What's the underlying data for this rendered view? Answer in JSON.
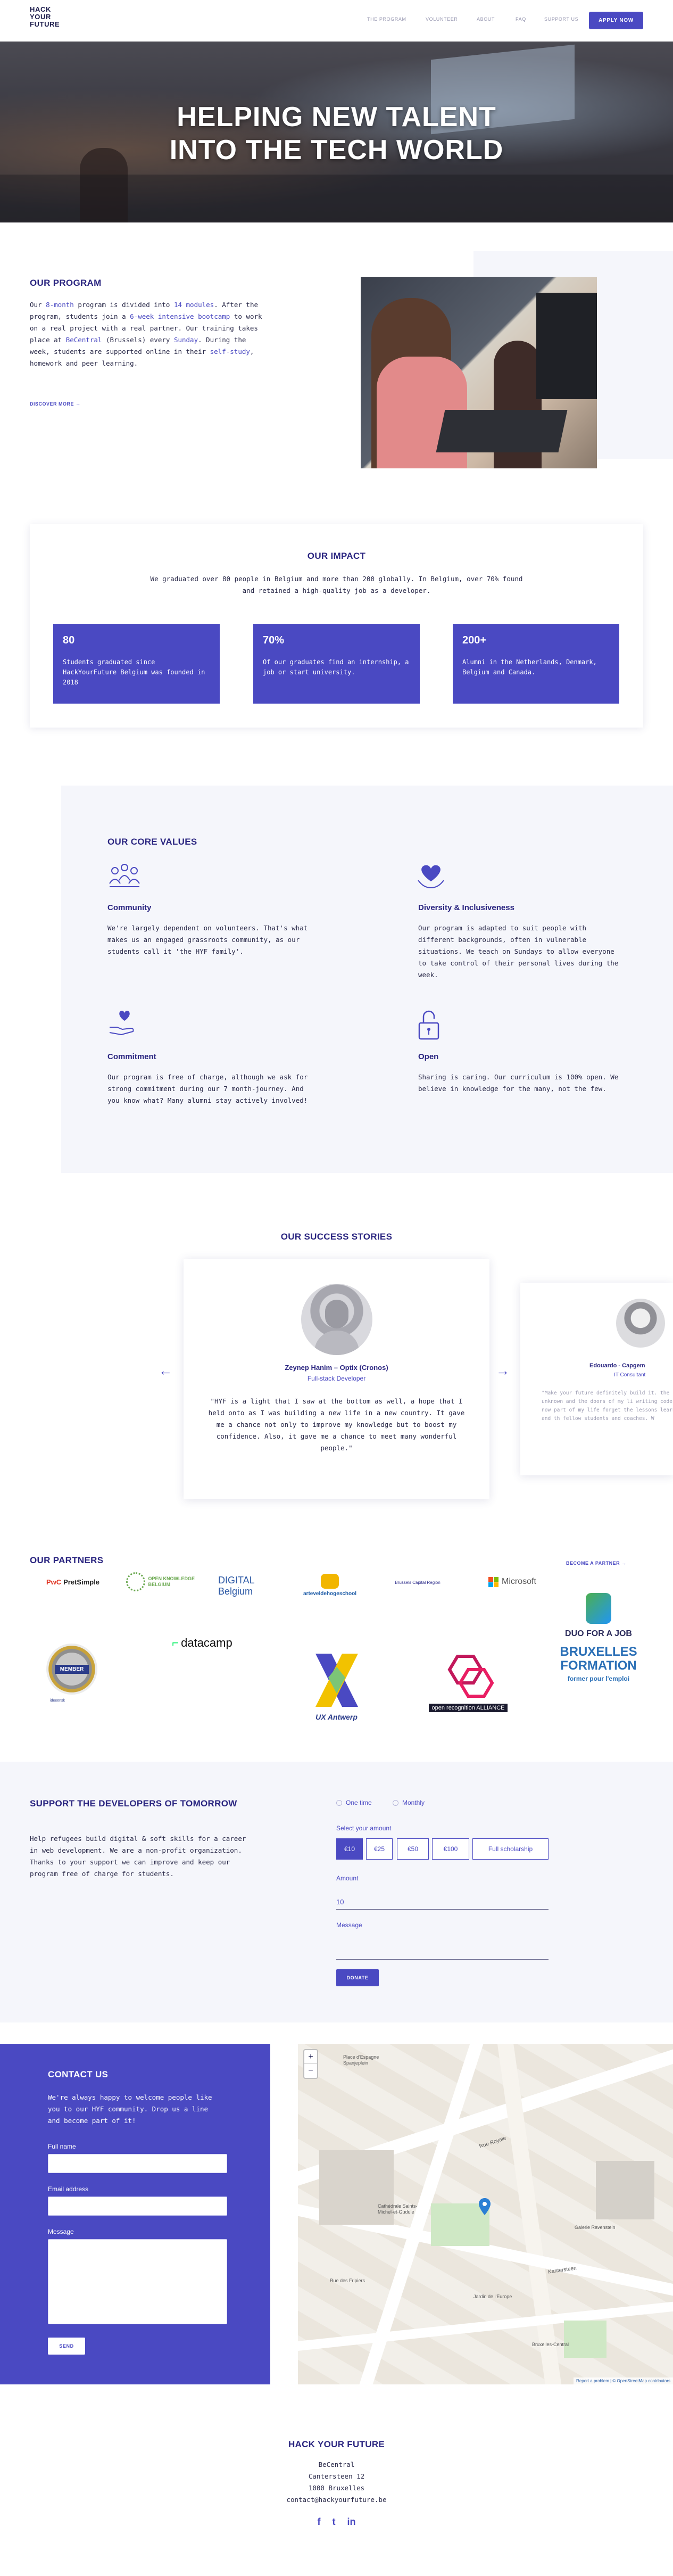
{
  "header": {
    "logo_lines": [
      "HACK",
      "YOUR",
      "FUTURE"
    ],
    "nav": [
      "THE PROGRAM",
      "VOLUNTEER",
      "ABOUT",
      "FAQ",
      "SUPPORT US"
    ],
    "apply_label": "APPLY NOW"
  },
  "hero": {
    "title_line1": "HELPING NEW TALENT",
    "title_line2": "INTO THE TECH WORLD"
  },
  "program": {
    "title": "OUR PROGRAM",
    "p1": "Our ",
    "p1_link": "8-month",
    "p2": " program is divided into ",
    "p2_link": "14 modules",
    "p3": ". After the program, students join a ",
    "p3_link": "6-week intensive bootcamp",
    "p4": " to work on a real project with a real partner. Our training takes place at ",
    "p4_link": "BeCentral",
    "p5": " (Brussels) every ",
    "p5_link": "Sunday",
    "p6": ". During the week, students are supported online in their ",
    "p6_link": "self-study",
    "p7": ", homework and peer learning.",
    "discover_label": "DISCOVER MORE",
    "discover_arrow": "→"
  },
  "impact": {
    "title": "OUR IMPACT",
    "text": "We graduated over 80 people in Belgium and more than 200 globally. In Belgium, over 70% found and retained a high-quality job as a developer.",
    "cards": [
      {
        "num": "80",
        "text": "Students graduated since HackYourFuture Belgium was founded in 2018"
      },
      {
        "num": "70%",
        "text": "Of our graduates find an internship, a job or start university."
      },
      {
        "num": "200+",
        "text": "Alumni in the Netherlands, Denmark, Belgium and Canada."
      }
    ]
  },
  "values": {
    "title": "OUR CORE VALUES",
    "items": [
      {
        "title": "Community",
        "text": "We're largely dependent on volunteers. That's what makes us an engaged grassroots community, as our students call it 'the HYF family'.",
        "icon": "community-icon"
      },
      {
        "title": "Diversity & Inclusiveness",
        "text": "Our program is adapted to suit people with different backgrounds, often in vulnerable situations. We teach on Sundays to allow everyone to take control of their personal lives during the week.",
        "icon": "heart-hands-icon"
      },
      {
        "title": "Commitment",
        "text": "Our program is free of charge, although we ask for strong commitment during our 7 month-journey. And you know what? Many alumni stay actively involved!",
        "icon": "hand-heart-icon"
      },
      {
        "title": "Open",
        "text": "Sharing is caring. Our curriculum is 100% open. We believe in knowledge for the many, not the few.",
        "icon": "open-lock-icon"
      }
    ]
  },
  "stories": {
    "title": "OUR SUCCESS STORIES",
    "main": {
      "name": "Zeynep Hanim – Optix (Cronos)",
      "role": "Full-stack Developer",
      "quote": "\"HYF is a light that I saw at the bottom as well, a hope that I held onto  as I was building a new life in a new country. It gave me a chance not  only to improve my knowledge but to boost my confidence. Also, it gave me a chance to meet many  wonderful people.\""
    },
    "side": {
      "name": "Edouardo - Capgem",
      "role": "IT Consultant",
      "quote": "\"Make your future definitely build it. the unknown and the doors of my li writing code is now part of my life forget the lessons learned and th fellow students and coaches. W"
    },
    "prev_arrow": "←",
    "next_arrow": "→"
  },
  "partners": {
    "title": "OUR PARTNERS",
    "become_label": "BECOME A PARTNER",
    "become_arrow": "→",
    "logos": [
      "PwC",
      "PretSimple",
      "OPEN KNOWLEDGE BELGIUM",
      "DIGITAL Belgium",
      "arteveldehogeschool",
      "Brussels Capital Region",
      "Microsoft",
      "MEMBER",
      "datacamp",
      "UX Antwerp",
      "open recognition ALLIANCE",
      "DUO FOR A JOB",
      "BRUXELLES FORMATION",
      "former pour l'emploi",
      "ideeënsk"
    ]
  },
  "support": {
    "title": "SUPPORT THE DEVELOPERS OF TOMORROW",
    "text": "Help refugees build digital & soft skills for a career in web development. We are a non-profit organization. Thanks to your support we can improve and keep our program free of charge for students.",
    "freq_options": [
      "One time",
      "Monthly"
    ],
    "amount_label": "Select your amount",
    "amounts": [
      "€10",
      "€25",
      "€50",
      "€100",
      "Full scholarship"
    ],
    "amount_field_label": "Amount",
    "amount_value": "10",
    "message_label": "Message",
    "donate_label": "DONATE"
  },
  "contact": {
    "title": "CONTACT US",
    "text": "We're always happy to welcome people like you to our HYF community. Drop us a line and become part of it!",
    "name_label": "Full name",
    "email_label": "Email address",
    "message_label": "Message",
    "send_label": "SEND"
  },
  "map": {
    "labels": [
      "Place d'Espagne Spanjeplein",
      "Cathédrale Saints-Michel-et-Gudule",
      "Rue Royale",
      "Rue des Fripiers",
      "Galerie Ravenstein",
      "Kantersteen",
      "Jardin de l'Europe",
      "Bruxelles-Central"
    ],
    "zoom_in": "+",
    "zoom_out": "−",
    "attribution_links": "Report a problem | © OpenStreetMap contributors"
  },
  "footer": {
    "title": "HACK YOUR FUTURE",
    "lines": [
      "BeCentral",
      "Cantersteen 12",
      "1000 Bruxelles",
      "contact@hackyourfuture.be"
    ],
    "social": [
      "f",
      "t",
      "in"
    ]
  },
  "colors": {
    "brand": "#4a49c2",
    "navy": "#2a2580",
    "panel": "#f5f6fb"
  }
}
